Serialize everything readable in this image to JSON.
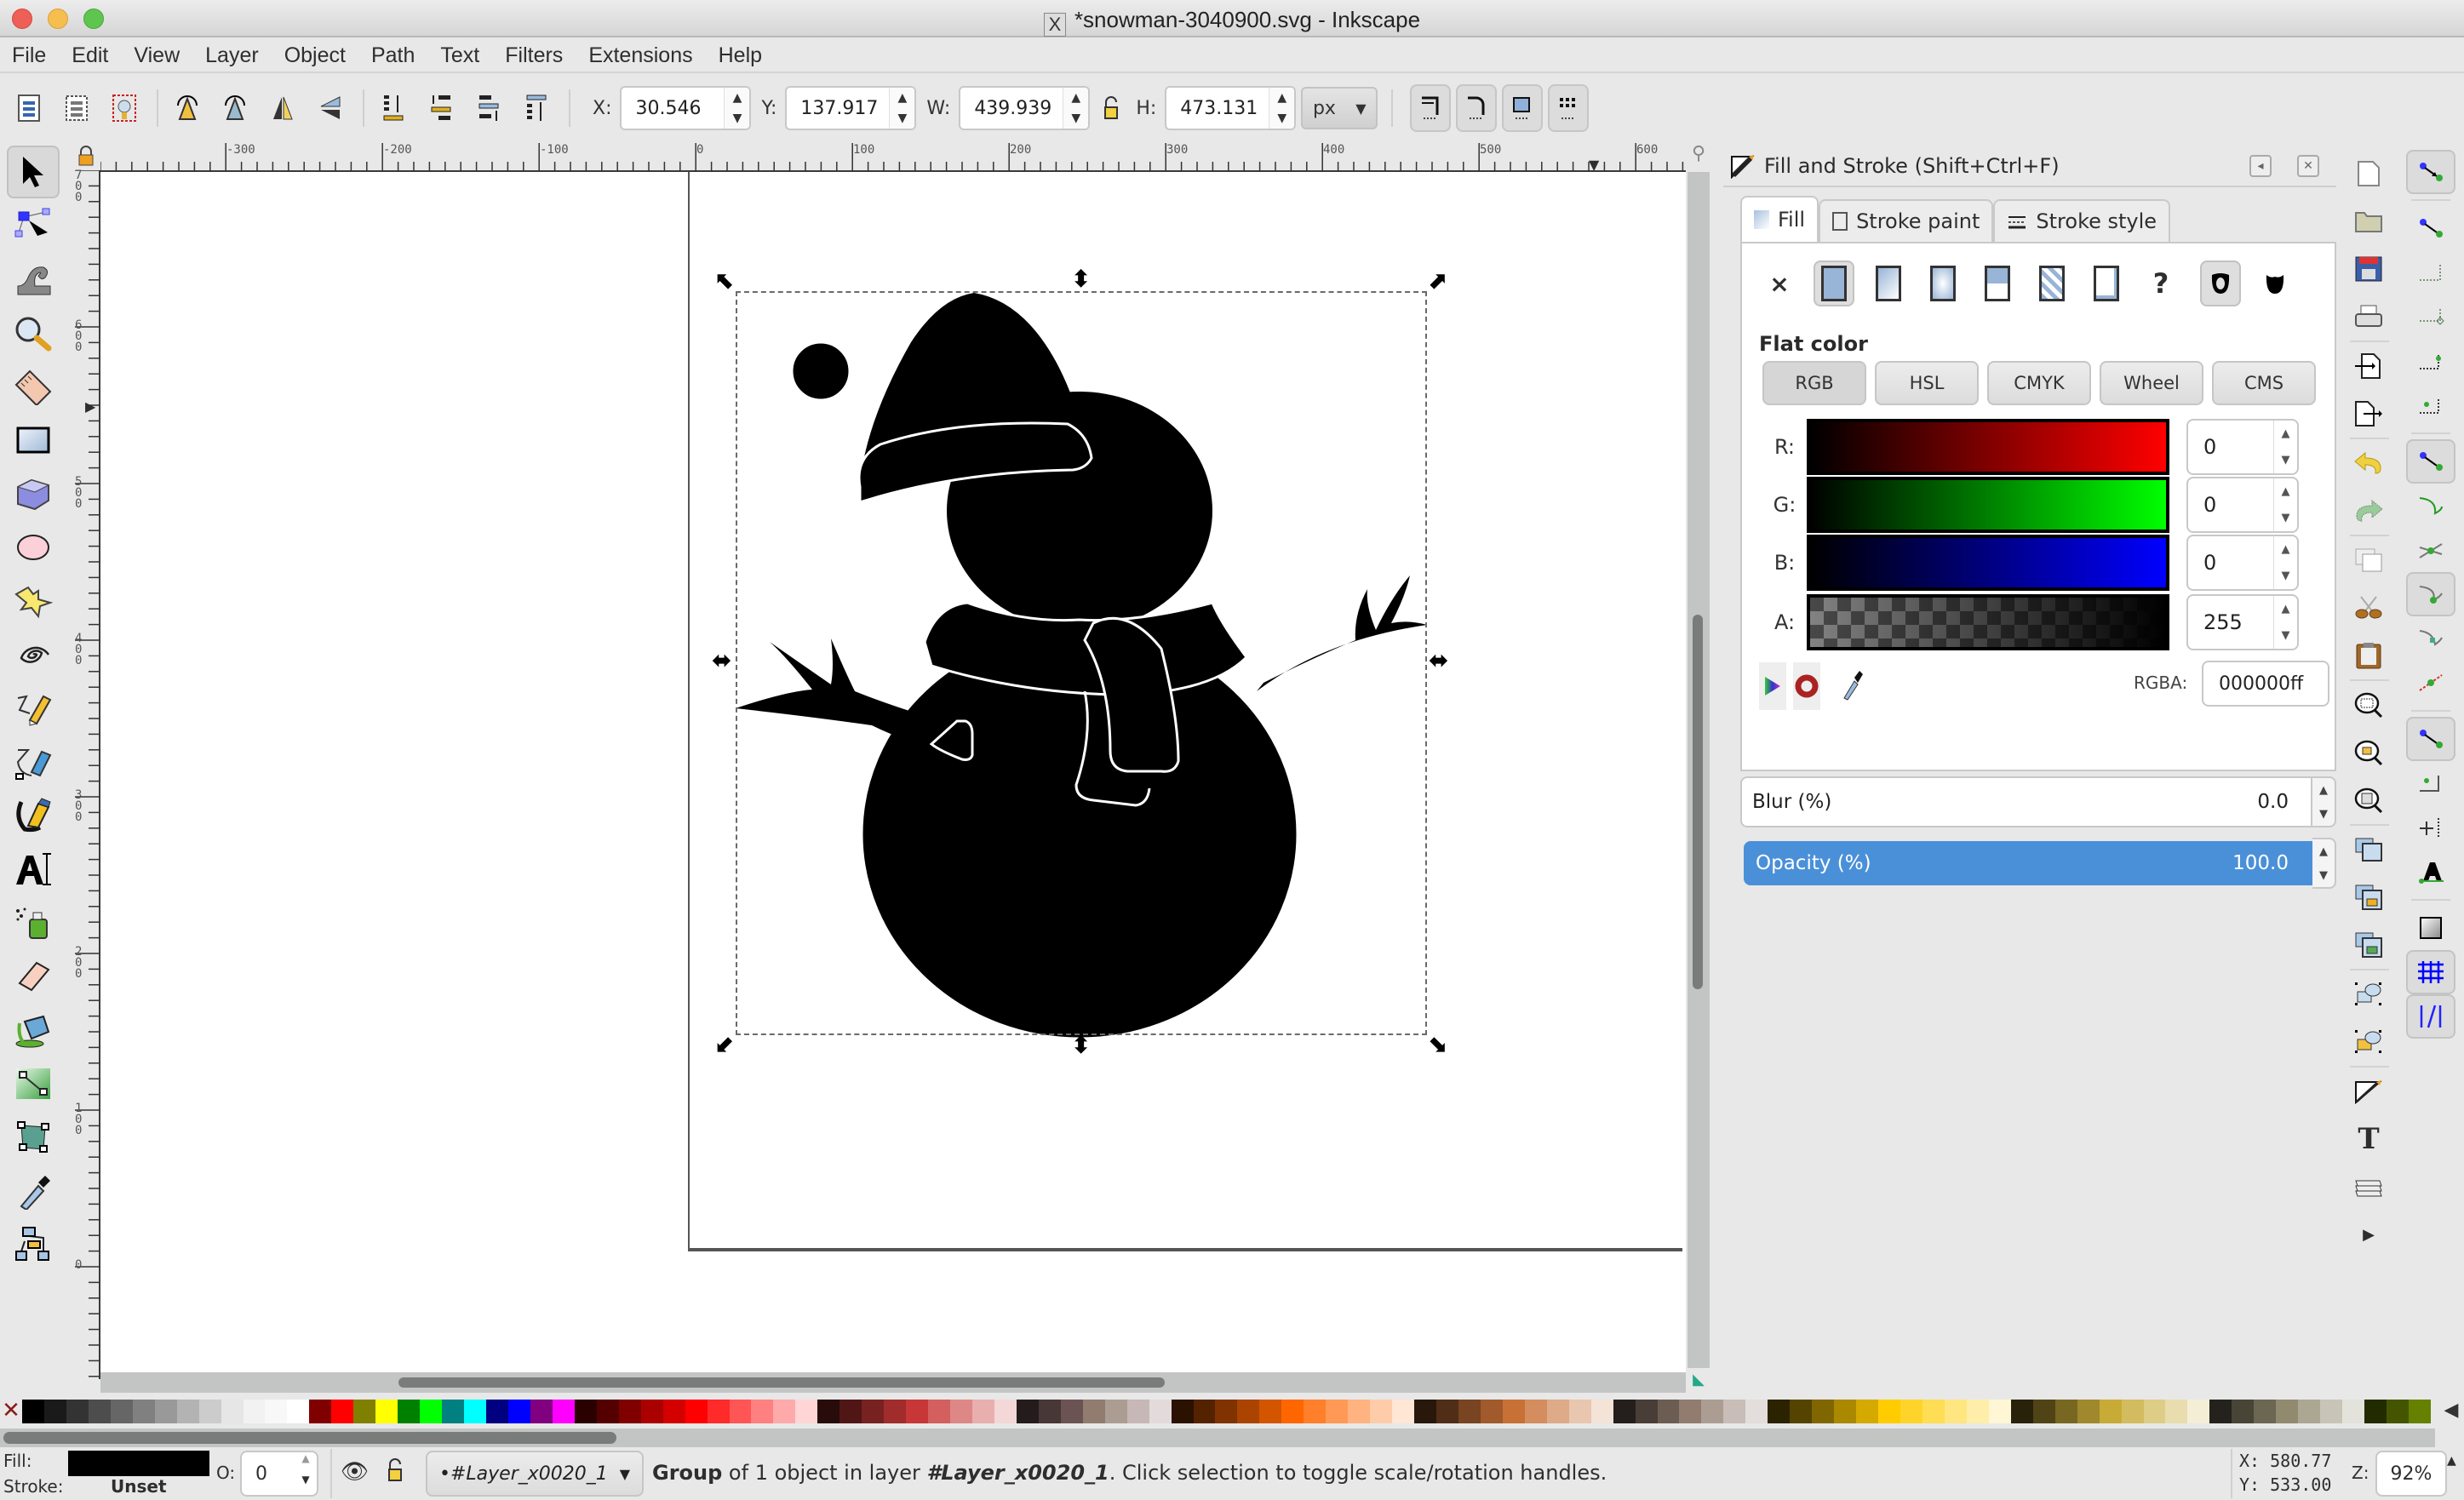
{
  "window": {
    "title": "*snowman-3040900.svg - Inkscape",
    "controls": [
      "close",
      "minimize",
      "maximize"
    ]
  },
  "menu": [
    "File",
    "Edit",
    "View",
    "Layer",
    "Object",
    "Path",
    "Text",
    "Filters",
    "Extensions",
    "Help"
  ],
  "toolbar": {
    "x_label": "X:",
    "x_value": "30.546",
    "y_label": "Y:",
    "y_value": "137.917",
    "w_label": "W:",
    "w_value": "439.939",
    "h_label": "H:",
    "h_value": "473.131",
    "unit": "px",
    "selection_icons": [
      "select-all-icon",
      "select-all-in-all-layers-icon",
      "deselect-icon"
    ],
    "transform_icons": [
      "rotate-ccw-icon",
      "rotate-cw-icon",
      "flip-horizontal-icon",
      "flip-vertical-icon"
    ],
    "zorder_icons": [
      "lower-to-bottom-icon",
      "lower-icon",
      "raise-icon",
      "raise-to-top-icon"
    ],
    "scale_option_icons": [
      "scale-stroke-icon",
      "scale-corners-icon",
      "transform-gradients-icon",
      "transform-patterns-icon"
    ]
  },
  "tools": [
    "selector-tool",
    "node-tool",
    "tweak-tool",
    "zoom-tool",
    "measure-tool",
    "rectangle-tool",
    "3d-box-tool",
    "ellipse-tool",
    "star-tool",
    "spiral-tool",
    "pencil-tool",
    "pen-tool",
    "calligraphy-tool",
    "text-tool",
    "spray-tool",
    "eraser-tool",
    "paint-bucket-tool",
    "gradient-tool",
    "mesh-tool",
    "dropper-tool",
    "connector-tool"
  ],
  "active_tool": "selector-tool",
  "rulers": {
    "top_labels": [
      "-300",
      "-200",
      "-100",
      "0",
      "100",
      "200",
      "300",
      "400",
      "500",
      "600"
    ],
    "left_labels": [
      "700",
      "600",
      "500",
      "400",
      "300",
      "200",
      "100",
      "0"
    ]
  },
  "dock": {
    "title": "Fill and Stroke (Shift+Ctrl+F)",
    "tabs": [
      {
        "label": "Fill",
        "active": true
      },
      {
        "label": "Stroke paint",
        "active": false
      },
      {
        "label": "Stroke style",
        "active": false
      }
    ],
    "fill_types": [
      "no-paint",
      "flat-color",
      "linear-gradient",
      "radial-gradient",
      "pattern",
      "swatch",
      "mesh-gradient",
      "unset"
    ],
    "active_fill_type": "flat-color",
    "fill_rules": [
      "evenodd",
      "nonzero"
    ],
    "section_label": "Flat color",
    "color_modes": [
      {
        "label": "RGB",
        "active": true
      },
      {
        "label": "HSL",
        "active": false
      },
      {
        "label": "CMYK",
        "active": false
      },
      {
        "label": "Wheel",
        "active": false
      },
      {
        "label": "CMS",
        "active": false
      }
    ],
    "channels": [
      {
        "label": "R:",
        "value": "0",
        "color": "#ff0000"
      },
      {
        "label": "G:",
        "value": "0",
        "color": "#00ff00"
      },
      {
        "label": "B:",
        "value": "0",
        "color": "#0000ff"
      },
      {
        "label": "A:",
        "value": "255",
        "color": "#000000"
      }
    ],
    "rgba_label": "RGBA:",
    "rgba_value": "000000ff",
    "blur_label": "Blur (%)",
    "blur_value": "0.0",
    "opacity_label": "Opacity (%)",
    "opacity_value": "100.0"
  },
  "commands": [
    "new-document-icon",
    "open-icon",
    "save-icon",
    "print-icon",
    "import-icon",
    "export-icon",
    "undo-icon",
    "redo-icon",
    "copy-icon",
    "cut-icon",
    "paste-icon",
    "zoom-selection-icon",
    "zoom-drawing-icon",
    "zoom-page-icon",
    "duplicate-icon",
    "clone-icon",
    "unlink-clone-icon",
    "group-icon",
    "ungroup-icon",
    "fill-stroke-icon",
    "text-font-icon",
    "layers-icon",
    "more-icon"
  ],
  "snap_controls": [
    "snap-toggle",
    "snap-bbox",
    "snap-bbox-edges",
    "snap-bbox-corners",
    "snap-bbox-midpoints",
    "snap-bbox-centers",
    "snap-nodes",
    "snap-paths",
    "snap-path-intersections",
    "snap-cusp-nodes",
    "snap-smooth-nodes",
    "snap-midpoints",
    "snap-others",
    "snap-object-centers",
    "snap-rotation-centers",
    "snap-text-baseline",
    "snap-page-border",
    "snap-grids",
    "snap-guides"
  ],
  "palette": [
    "#000000",
    "#1a1a1a",
    "#333333",
    "#4d4d4d",
    "#666666",
    "#808080",
    "#999999",
    "#b3b3b3",
    "#cccccc",
    "#e6e6e6",
    "#f2f2f2",
    "#f8f8f8",
    "#ffffff",
    "#800000",
    "#ff0000",
    "#808000",
    "#ffff00",
    "#008000",
    "#00ff00",
    "#008080",
    "#00ffff",
    "#000080",
    "#0000ff",
    "#800080",
    "#ff00ff",
    "#2b0000",
    "#550000",
    "#800000",
    "#aa0000",
    "#d40000",
    "#ff0000",
    "#ff2a2a",
    "#ff5555",
    "#ff8080",
    "#ffaaaa",
    "#ffd5d5",
    "#280b0b",
    "#501616",
    "#782121",
    "#a02c2c",
    "#c83737",
    "#d35f5f",
    "#de8787",
    "#e9afaf",
    "#f4d7d7",
    "#241c1c",
    "#483737",
    "#6c5353",
    "#917c6f",
    "#ac9d93",
    "#c8b7b7",
    "#e3dbdb",
    "#2b1100",
    "#552200",
    "#803300",
    "#aa4400",
    "#d45500",
    "#ff6600",
    "#ff7f2a",
    "#ff9955",
    "#ffb380",
    "#ffccaa",
    "#ffe6d5",
    "#28170b",
    "#502d16",
    "#784421",
    "#a05a2c",
    "#c87137",
    "#d38d5f",
    "#deaa87",
    "#e9c6af",
    "#f4e3d7",
    "#241f1c",
    "#483e37",
    "#6c5d53",
    "#917c6f",
    "#ac9d93",
    "#c8beb7",
    "#e3dedb",
    "#2b2200",
    "#554400",
    "#806600",
    "#aa8800",
    "#d4aa00",
    "#ffcc00",
    "#ffd42a",
    "#ffdd55",
    "#ffe680",
    "#ffeeaa",
    "#fff6d5",
    "#28220b",
    "#504416",
    "#786721",
    "#a0892c",
    "#c8ab37",
    "#d3bc5f",
    "#decd87",
    "#e9ddaf",
    "#f4eed7",
    "#24221c",
    "#484537",
    "#6c6753",
    "#918a6f",
    "#aca793",
    "#c8c4b7",
    "#e3e2db",
    "#222b00",
    "#445500",
    "#668000"
  ],
  "status": {
    "fill_label": "Fill:",
    "stroke_label": "Stroke:",
    "stroke_value": "Unset",
    "fill_color": "#000000",
    "opacity_label": "O:",
    "opacity_value": "0",
    "layer": "•#Layer_x0020_1",
    "message_bold": "Group",
    "message_rest": " of 1 object in layer ",
    "message_layer": "#Layer_x0020_1",
    "message_end": ". Click selection to toggle scale/rotation handles.",
    "cursor_x": "X:  580.77",
    "cursor_y": "Y:  533.00",
    "zoom_label": "Z:",
    "zoom_value": "92%"
  }
}
